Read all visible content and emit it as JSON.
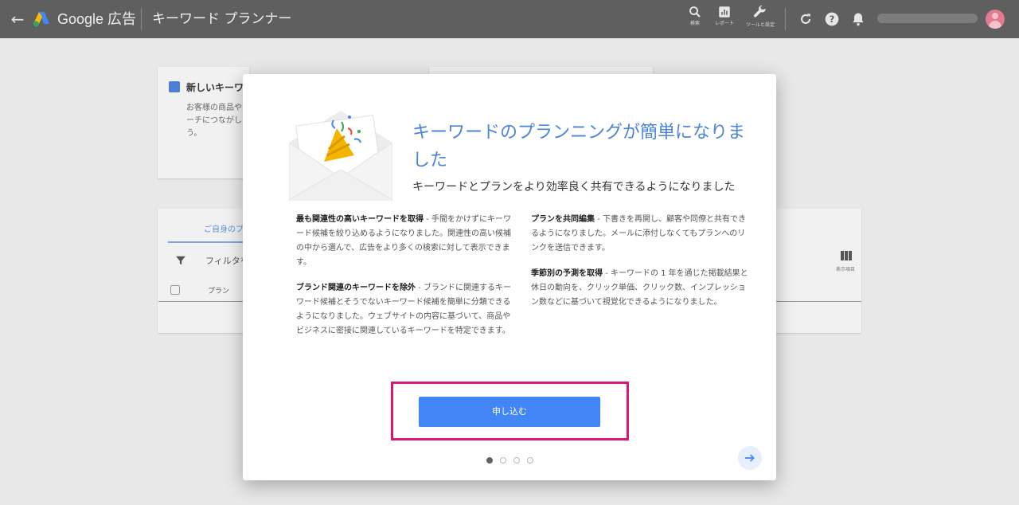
{
  "topbar": {
    "brand": "Google 広告",
    "product": "キーワード プランナー",
    "tools": [
      {
        "label": "検索",
        "icon": "search-icon"
      },
      {
        "label": "レポート",
        "icon": "bar-chart-icon"
      },
      {
        "label": "ツールと設定",
        "icon": "wrench-icon"
      }
    ],
    "icons": [
      "refresh-icon",
      "help-icon",
      "bell-icon"
    ]
  },
  "background": {
    "card_title": "新しいキーワー",
    "card_text": "お客様の商品やリーチにつながしょう。",
    "tab": "ご自身のプ",
    "filter": "フィルタを",
    "column_plan": "プラン",
    "columns_label": "表示項目"
  },
  "modal": {
    "title": "キーワードのプランニングが簡単になりました",
    "subtitle": "キーワードとプランをより効率良く共有できるようになりました",
    "features": [
      {
        "heading": "最も関連性の高いキーワードを取得",
        "text": " - 手間をかけずにキーワード候補を絞り込めるようになりました。関連性の高い候補の中から選んで、広告をより多くの検索に対して表示できます。"
      },
      {
        "heading": "ブランド関連のキーワードを除外",
        "text": " - ブランドに関連するキーワード候補とそうでないキーワード候補を簡単に分類できるようになりました。ウェブサイトの内容に基づいて、商品やビジネスに密接に関連しているキーワードを特定できます。"
      },
      {
        "heading": "プランを共同編集",
        "text": " - 下書きを再開し、顧客や同僚と共有できるようになりました。メールに添付しなくてもプランへのリンクを送信できます。"
      },
      {
        "heading": "季節別の予測を取得",
        "text": " - キーワードの 1 年を通じた掲載結果と休日の動向を、クリック単価、クリック数、インプレッション数などに基づいて視覚化できるようになりました。"
      }
    ],
    "cta_label": "申し込む",
    "pager": {
      "current": 1,
      "total": 4
    }
  },
  "colors": {
    "accent": "#4285f4",
    "title": "#4a84d9",
    "highlight_frame": "#d6197a",
    "topbar": "#5f5f5f"
  }
}
